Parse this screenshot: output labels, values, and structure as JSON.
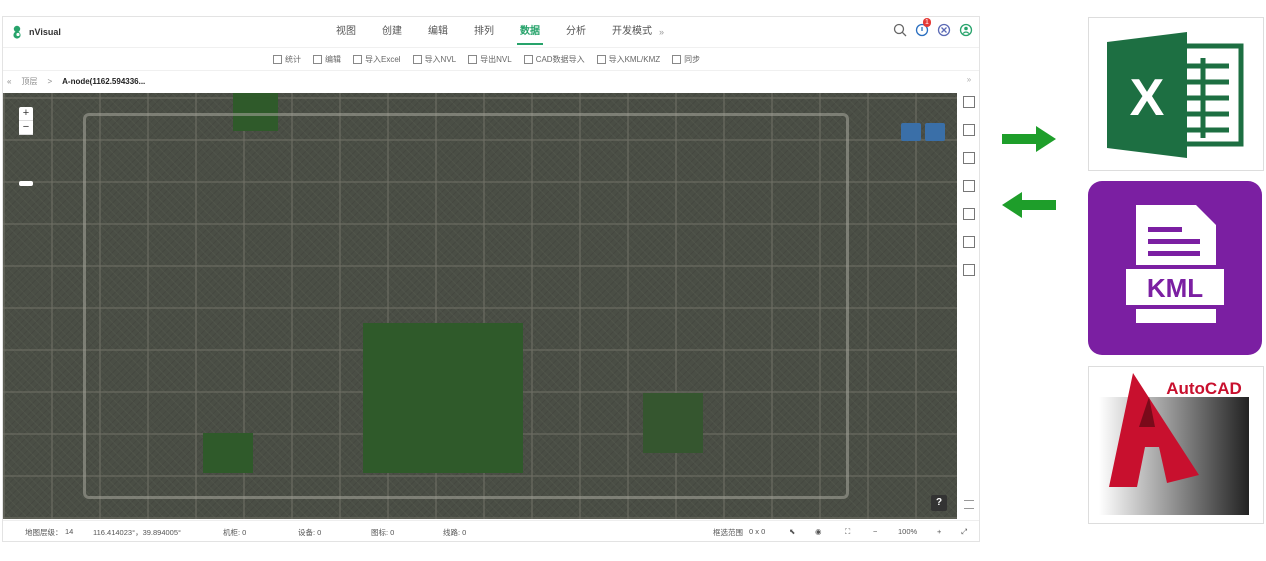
{
  "app": {
    "name": "nVisual",
    "menu": [
      {
        "label": "视图",
        "active": false
      },
      {
        "label": "创建",
        "active": false
      },
      {
        "label": "编辑",
        "active": false
      },
      {
        "label": "排列",
        "active": false
      },
      {
        "label": "数据",
        "active": true
      },
      {
        "label": "分析",
        "active": false
      },
      {
        "label": "开发模式",
        "active": false
      }
    ],
    "menu_more": "»",
    "notification_count": "1",
    "toolbar": [
      "统计",
      "编辑",
      "导入Excel",
      "导入NVL",
      "导出NVL",
      "CAD数据导入",
      "导入KML/KMZ",
      "同步"
    ],
    "breadcrumb": {
      "root": "顶层",
      "separator": ">",
      "current": "A-node(1162.594336..."
    },
    "map": {
      "zoom_in": "+",
      "zoom_out": "−",
      "help": "?"
    },
    "status": {
      "level_label": "地图层级：",
      "level_value": "14",
      "coords": "116.414023°，39.894005°",
      "rack": "机柜: 0",
      "device": "设备: 0",
      "icon": "图标: 0",
      "line": "线路: 0",
      "range_label": "框选范围",
      "range_value": "0 x 0",
      "zoom": "100%",
      "minus": "−",
      "plus": "+"
    }
  },
  "right_panel": {
    "excel_letter": "X",
    "kml_label": "KML",
    "autocad_label": "AutoCAD",
    "colors": {
      "excel": "#1d6f42",
      "kml": "#7b1fa2",
      "arrow": "#1e9e2a",
      "accent": "#27a36b"
    }
  }
}
